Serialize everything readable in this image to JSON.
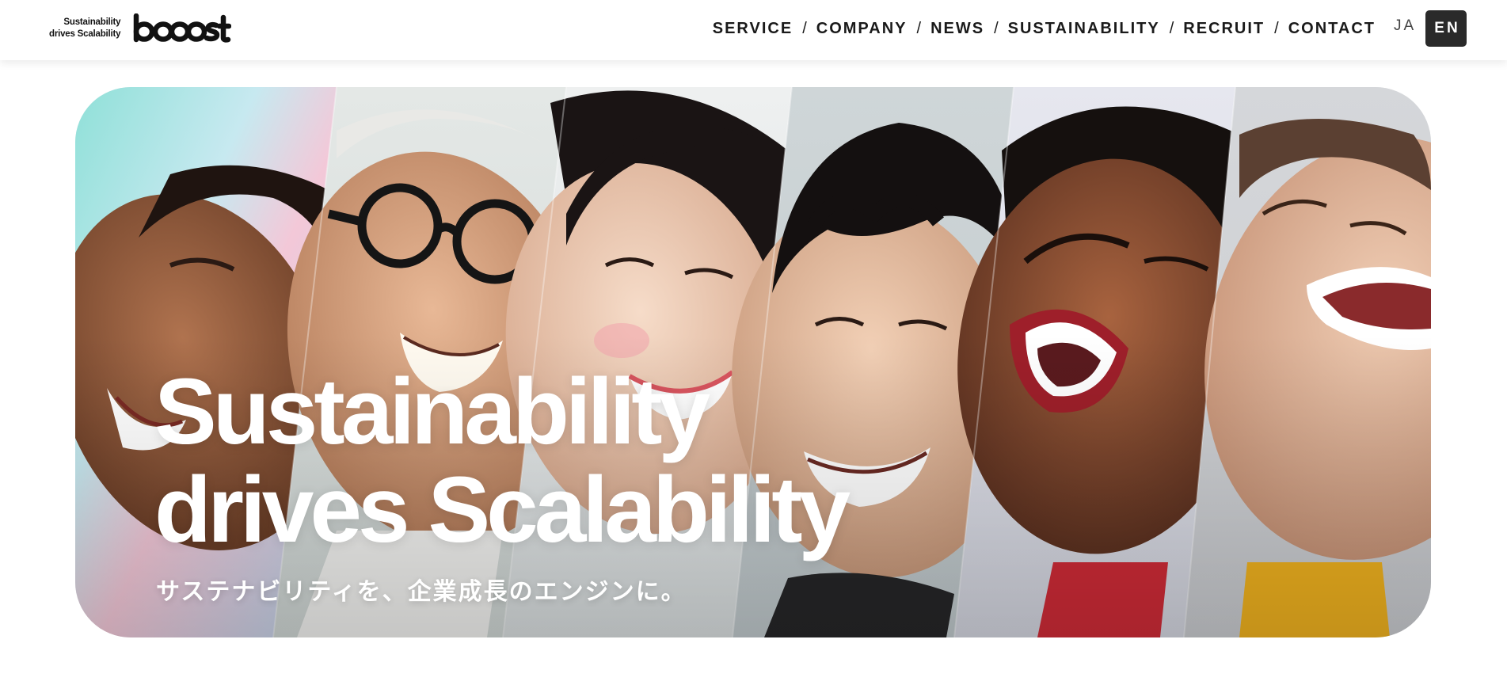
{
  "header": {
    "logo": {
      "tagline_line1": "Sustainability",
      "tagline_line2": "drives Scalability",
      "wordmark": "booost"
    },
    "nav": [
      {
        "label": "SERVICE"
      },
      {
        "label": "COMPANY"
      },
      {
        "label": "NEWS"
      },
      {
        "label": "SUSTAINABILITY"
      },
      {
        "label": "RECRUIT"
      },
      {
        "label": "CONTACT"
      }
    ],
    "nav_separator": "/",
    "languages": {
      "ja": "JA",
      "en": "EN",
      "active": "en"
    }
  },
  "hero": {
    "title_line1": "Sustainability",
    "title_line2": "drives Scalability",
    "subtitle": "サステナビリティを、企業成長のエンジンに。"
  }
}
